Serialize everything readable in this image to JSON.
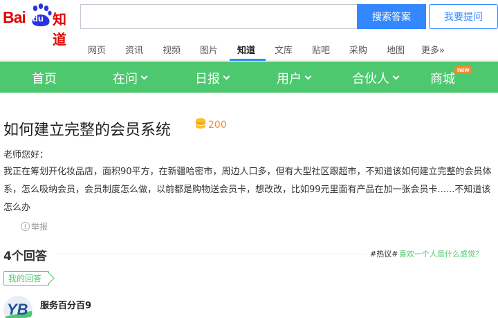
{
  "header": {
    "logo": {
      "bai": "Bai",
      "du": "du",
      "zhidao": "知道"
    },
    "search": {
      "value": "",
      "placeholder": ""
    },
    "search_button": "搜索答案",
    "ask_button": "我要提问"
  },
  "channels": [
    "网页",
    "资讯",
    "视频",
    "图片",
    "知道",
    "文库",
    "贴吧",
    "采购",
    "地图",
    "更多»"
  ],
  "active_channel": "知道",
  "green_nav": {
    "items": [
      "首页",
      "在问",
      "日报",
      "用户",
      "合伙人",
      "商城"
    ],
    "new_badge": "new"
  },
  "question": {
    "title": "如何建立完整的会员系统",
    "reward": "200",
    "greeting": "老师您好：",
    "body": "我正在筹划开化妆品店，面积90平方，在新疆哈密市，周边人口多，但有大型社区跟超市，不知道该如何建立完整的会员体系，怎么吸纳会员，会员制度怎么做，以前都是购物送会员卡，想改改，比如99元里面有产品在加一张会员卡......不知道该怎么办",
    "report": "举报"
  },
  "answers": {
    "count_label": "4个回答",
    "hot_tag": "#热议#",
    "hot_link": "喜欢一个人是什么感觉？",
    "my_answer_label": "我的回答",
    "first_answerer": "服务百分百9"
  },
  "colors": {
    "accent": "#3388ff",
    "green": "#4dc86f",
    "brand_red": "#e10602",
    "orange": "#f7892c"
  }
}
